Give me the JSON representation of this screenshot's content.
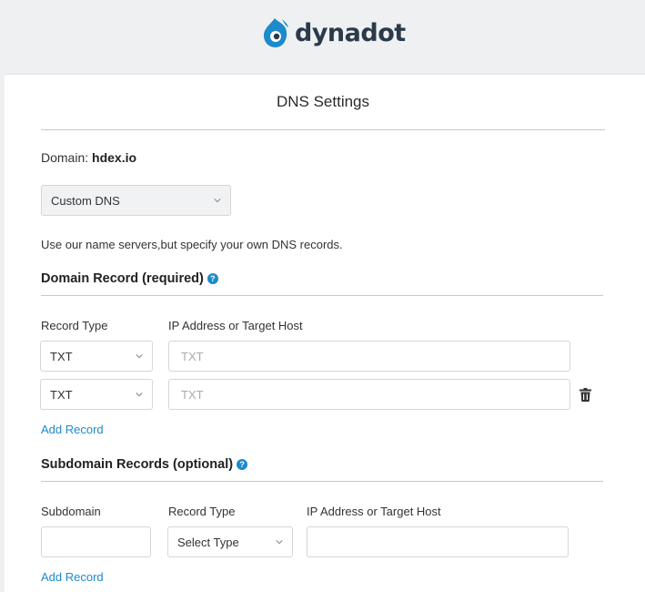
{
  "brand": {
    "name": "dynadot"
  },
  "page": {
    "title": "DNS Settings"
  },
  "domain": {
    "label": "Domain:",
    "value": "hdex.io"
  },
  "dns_mode": {
    "selected": "Custom DNS",
    "description": "Use our name servers,but specify your own DNS records."
  },
  "domain_record": {
    "title": "Domain Record (required)",
    "help": "?",
    "col_type": "Record Type",
    "col_target": "IP Address or Target Host",
    "rows": [
      {
        "type": "TXT",
        "placeholder": "TXT"
      },
      {
        "type": "TXT",
        "placeholder": "TXT"
      }
    ],
    "add_label": "Add Record"
  },
  "subdomain_records": {
    "title": "Subdomain Records (optional)",
    "help": "?",
    "col_subdomain": "Subdomain",
    "col_type": "Record Type",
    "col_target": "IP Address or Target Host",
    "type_selected": "Select Type",
    "add_label": "Add Record"
  },
  "colors": {
    "accent": "#1d8acb",
    "brand_dark": "#2b3a4a"
  }
}
